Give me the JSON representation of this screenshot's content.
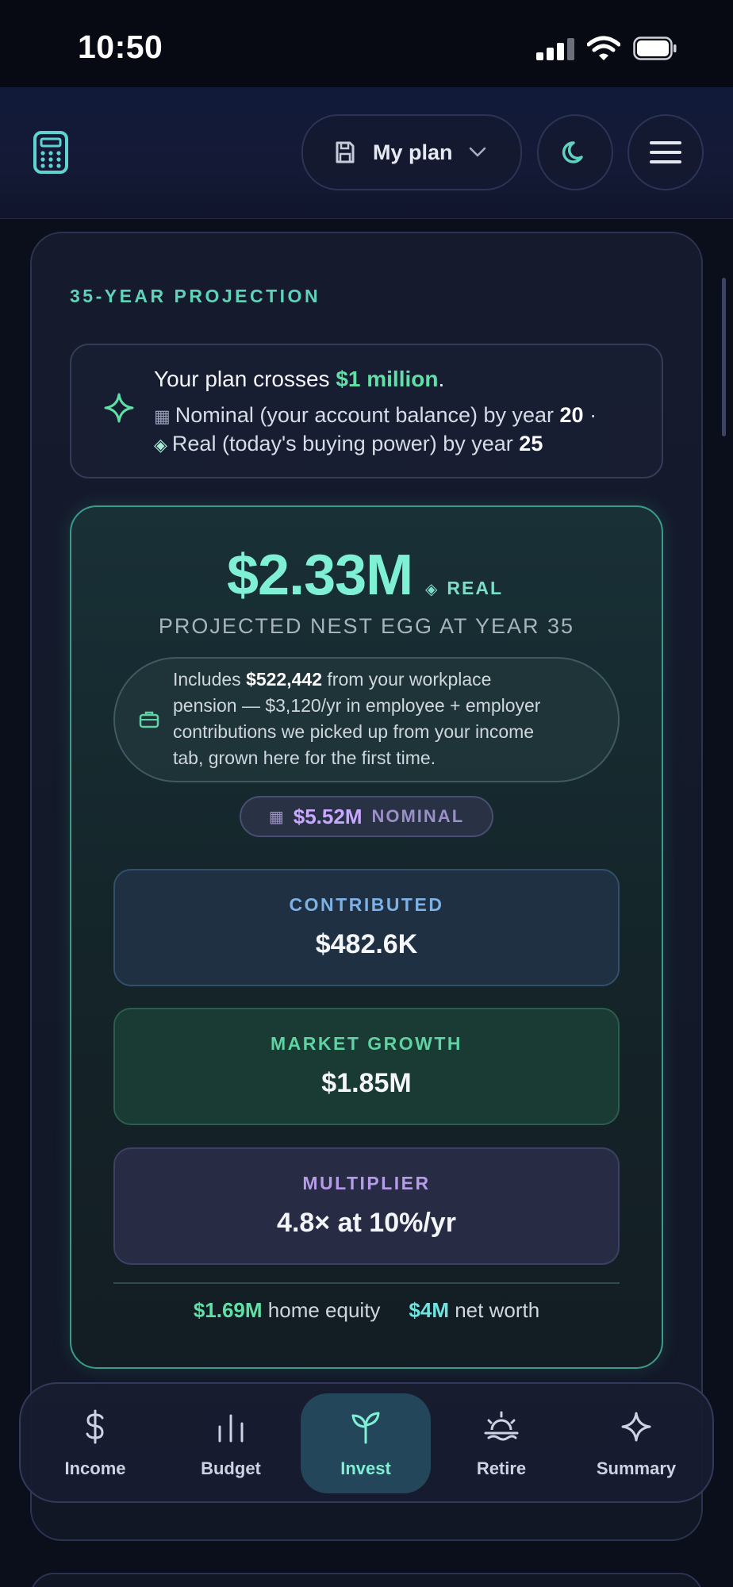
{
  "status_bar": {
    "time": "10:50"
  },
  "header": {
    "plan_label": "My plan",
    "icons": [
      "calculator-icon",
      "save-icon",
      "chevron-down-icon",
      "moon-icon",
      "menu-icon"
    ]
  },
  "projection": {
    "section_title": "35-YEAR PROJECTION",
    "milestone": {
      "prefix": "Your plan crosses ",
      "highlight": "$1 million",
      "suffix": ".",
      "nominal_text": "Nominal (your account balance) by year ",
      "nominal_year": "20",
      "nominal_sep": " ·",
      "real_text": "Real (today's buying power) by year ",
      "real_year": "25"
    },
    "big_value": "$2.33M",
    "real_tag": "REAL",
    "caption": "PROJECTED NEST EGG AT YEAR 35",
    "pension": {
      "l1_pre": "Includes ",
      "l1_amount": "$522,442",
      "l1_post": " from your workplace",
      "l2": "pension — $3,120/yr in employee + employer",
      "l3": "contributions we picked up from your income",
      "l4": "tab, grown here for the first time."
    },
    "nominal_value": "$5.52M",
    "nominal_tag": "NOMINAL",
    "stats": {
      "contributed_label": "CONTRIBUTED",
      "contributed_value": "$482.6K",
      "growth_label": "MARKET GROWTH",
      "growth_value": "$1.85M",
      "multiplier_label": "MULTIPLIER",
      "multiplier_value": "4.8× at 10%/yr"
    },
    "footer": {
      "home_equity_value": "$1.69M",
      "home_equity_label": " home equity",
      "net_worth_value": "$4M",
      "net_worth_label": " net worth"
    }
  },
  "nav": {
    "items": [
      {
        "label": "Income",
        "icon": "dollar-icon"
      },
      {
        "label": "Budget",
        "icon": "bar-chart-icon"
      },
      {
        "label": "Invest",
        "icon": "sprout-icon",
        "active": true
      },
      {
        "label": "Retire",
        "icon": "sunset-icon"
      },
      {
        "label": "Summary",
        "icon": "sparkle-icon"
      }
    ]
  },
  "colors": {
    "accent_teal": "#7ff0d4",
    "accent_green": "#5fe0a6",
    "accent_purple": "#c9a9ff",
    "background": "#0b0f1c"
  }
}
